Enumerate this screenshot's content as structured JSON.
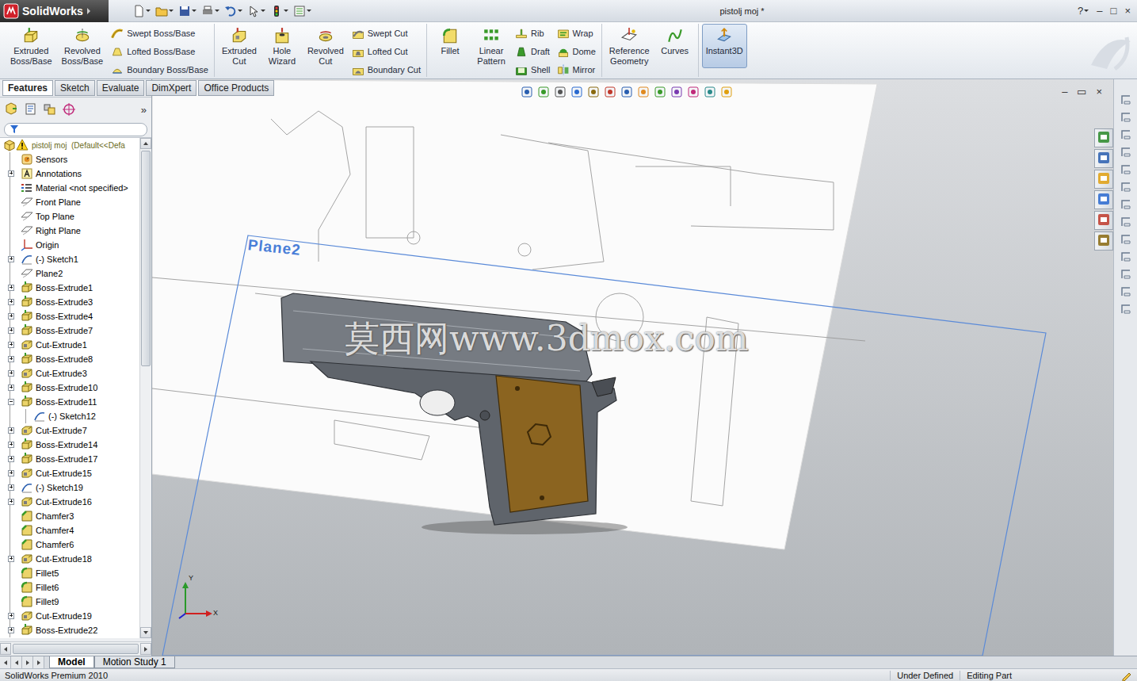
{
  "window": {
    "app": "SolidWorks",
    "title": "pistolj moj *",
    "help": "?",
    "controls": [
      "–",
      "□",
      "×"
    ]
  },
  "ribbon": {
    "groups": [
      {
        "large": [
          {
            "label": "Extruded Boss/Base",
            "kind": "extrude",
            "selected": false
          },
          {
            "label": "Revolved Boss/Base",
            "kind": "revolve",
            "selected": false
          }
        ],
        "small_columns": [
          [
            {
              "label": "Swept Boss/Base",
              "kind": "sweep",
              "selected": false
            },
            {
              "label": "Lofted Boss/Base",
              "kind": "loft",
              "selected": false
            },
            {
              "label": "Boundary Boss/Base",
              "kind": "boundary",
              "selected": false
            }
          ]
        ]
      },
      {
        "large": [
          {
            "label": "Extruded Cut",
            "kind": "cut",
            "selected": false
          },
          {
            "label": "Hole Wizard",
            "kind": "hole",
            "selected": false
          },
          {
            "label": "Revolved Cut",
            "kind": "revcut",
            "selected": false
          }
        ],
        "small_columns": [
          [
            {
              "label": "Swept Cut",
              "kind": "sweepcut",
              "selected": false
            },
            {
              "label": "Lofted Cut",
              "kind": "loftcut",
              "selected": false
            },
            {
              "label": "Boundary Cut",
              "kind": "boundcut",
              "selected": false
            }
          ]
        ]
      },
      {
        "large": [
          {
            "label": "Fillet",
            "kind": "fillet",
            "selected": false
          },
          {
            "label": "Linear Pattern",
            "kind": "pattern",
            "selected": false
          }
        ],
        "small_columns": [
          [
            {
              "label": "Rib",
              "kind": "rib",
              "selected": false
            },
            {
              "label": "Draft",
              "kind": "draft",
              "selected": false
            },
            {
              "label": "Shell",
              "kind": "shell",
              "selected": false
            }
          ],
          [
            {
              "label": "Wrap",
              "kind": "wrap",
              "selected": false
            },
            {
              "label": "Dome",
              "kind": "dome",
              "selected": false
            },
            {
              "label": "Mirror",
              "kind": "mirror",
              "selected": false
            }
          ]
        ]
      },
      {
        "large": [
          {
            "label": "Reference Geometry",
            "kind": "refgeom",
            "selected": false
          },
          {
            "label": "Curves",
            "kind": "curves",
            "selected": false
          }
        ],
        "small_columns": []
      },
      {
        "large": [
          {
            "label": "Instant3D",
            "kind": "instant3d",
            "selected": true
          }
        ],
        "small_columns": []
      }
    ]
  },
  "tabs": [
    {
      "label": "Features",
      "selected": true
    },
    {
      "label": "Sketch",
      "selected": false
    },
    {
      "label": "Evaluate",
      "selected": false
    },
    {
      "label": "DimXpert",
      "selected": false
    },
    {
      "label": "Office Products",
      "selected": false
    }
  ],
  "panel": {
    "more": "»"
  },
  "tree": {
    "root": {
      "label": "pistolj moj  (Default<<Defa",
      "warning": true
    },
    "items": [
      {
        "label": "Sensors",
        "kind": "sensor",
        "depth": 0,
        "expandable": false,
        "expanded": false
      },
      {
        "label": "Annotations",
        "kind": "annotation",
        "depth": 0,
        "expandable": true,
        "expanded": false
      },
      {
        "label": "Material <not specified>",
        "kind": "material",
        "depth": 0,
        "expandable": false,
        "expanded": false
      },
      {
        "label": "Front Plane",
        "kind": "plane",
        "depth": 0,
        "expandable": false,
        "expanded": false
      },
      {
        "label": "Top Plane",
        "kind": "plane",
        "depth": 0,
        "expandable": false,
        "expanded": false
      },
      {
        "label": "Right Plane",
        "kind": "plane",
        "depth": 0,
        "expandable": false,
        "expanded": false
      },
      {
        "label": "Origin",
        "kind": "origin",
        "depth": 0,
        "expandable": false,
        "expanded": false
      },
      {
        "label": "(-) Sketch1",
        "kind": "sketch",
        "depth": 0,
        "expandable": true,
        "expanded": false
      },
      {
        "label": "Plane2",
        "kind": "plane",
        "depth": 0,
        "expandable": false,
        "expanded": false
      },
      {
        "label": "Boss-Extrude1",
        "kind": "boss",
        "depth": 0,
        "expandable": true,
        "expanded": false
      },
      {
        "label": "Boss-Extrude3",
        "kind": "boss",
        "depth": 0,
        "expandable": true,
        "expanded": false
      },
      {
        "label": "Boss-Extrude4",
        "kind": "boss",
        "depth": 0,
        "expandable": true,
        "expanded": false
      },
      {
        "label": "Boss-Extrude7",
        "kind": "boss",
        "depth": 0,
        "expandable": true,
        "expanded": false
      },
      {
        "label": "Cut-Extrude1",
        "kind": "cut",
        "depth": 0,
        "expandable": true,
        "expanded": false
      },
      {
        "label": "Boss-Extrude8",
        "kind": "boss",
        "depth": 0,
        "expandable": true,
        "expanded": false
      },
      {
        "label": "Cut-Extrude3",
        "kind": "cut",
        "depth": 0,
        "expandable": true,
        "expanded": false
      },
      {
        "label": "Boss-Extrude10",
        "kind": "boss",
        "depth": 0,
        "expandable": true,
        "expanded": false
      },
      {
        "label": "Boss-Extrude11",
        "kind": "boss",
        "depth": 0,
        "expandable": true,
        "expanded": true
      },
      {
        "label": "(-) Sketch12",
        "kind": "sketch",
        "depth": 1,
        "expandable": false,
        "expanded": false
      },
      {
        "label": "Cut-Extrude7",
        "kind": "cut",
        "depth": 0,
        "expandable": true,
        "expanded": false
      },
      {
        "label": "Boss-Extrude14",
        "kind": "boss",
        "depth": 0,
        "expandable": true,
        "expanded": false
      },
      {
        "label": "Boss-Extrude17",
        "kind": "boss",
        "depth": 0,
        "expandable": true,
        "expanded": false
      },
      {
        "label": "Cut-Extrude15",
        "kind": "cut",
        "depth": 0,
        "expandable": true,
        "expanded": false
      },
      {
        "label": "(-) Sketch19",
        "kind": "sketch",
        "depth": 0,
        "expandable": true,
        "expanded": false
      },
      {
        "label": "Cut-Extrude16",
        "kind": "cut",
        "depth": 0,
        "expandable": true,
        "expanded": false
      },
      {
        "label": "Chamfer3",
        "kind": "chamfer",
        "depth": 0,
        "expandable": false,
        "expanded": false
      },
      {
        "label": "Chamfer4",
        "kind": "chamfer",
        "depth": 0,
        "expandable": false,
        "expanded": false
      },
      {
        "label": "Chamfer6",
        "kind": "chamfer",
        "depth": 0,
        "expandable": false,
        "expanded": false
      },
      {
        "label": "Cut-Extrude18",
        "kind": "cut",
        "depth": 0,
        "expandable": true,
        "expanded": false
      },
      {
        "label": "Fillet5",
        "kind": "fillet",
        "depth": 0,
        "expandable": false,
        "expanded": false
      },
      {
        "label": "Fillet6",
        "kind": "fillet",
        "depth": 0,
        "expandable": false,
        "expanded": false
      },
      {
        "label": "Fillet9",
        "kind": "fillet",
        "depth": 0,
        "expandable": false,
        "expanded": false
      },
      {
        "label": "Cut-Extrude19",
        "kind": "cut",
        "depth": 0,
        "expandable": true,
        "expanded": false
      },
      {
        "label": "Boss-Extrude22",
        "kind": "boss",
        "depth": 0,
        "expandable": true,
        "expanded": false
      }
    ]
  },
  "viewport": {
    "plane_label": "Plane2",
    "watermark": "莫西网www.3dmox.com",
    "controls": [
      "–",
      "▭",
      "×"
    ],
    "triad_labels": [
      "Y",
      "X"
    ]
  },
  "model_tabs": [
    {
      "label": "Model",
      "selected": true
    },
    {
      "label": "Motion Study 1",
      "selected": false
    }
  ],
  "status_bar": {
    "left": "SolidWorks Premium 2010",
    "right": [
      "Under Defined",
      "Editing Part"
    ]
  }
}
